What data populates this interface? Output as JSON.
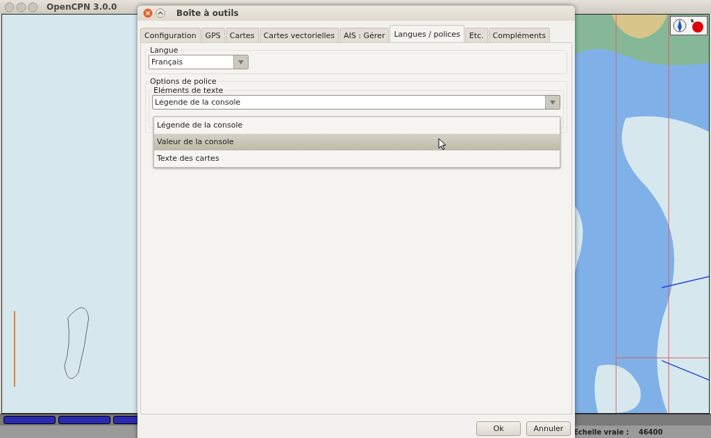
{
  "main_window": {
    "title": "OpenCPN 3.0.0"
  },
  "dialog": {
    "title": "Boîte à outils",
    "tabs": [
      {
        "label": "Configuration",
        "selected": false
      },
      {
        "label": "GPS",
        "selected": false
      },
      {
        "label": "Cartes",
        "selected": false
      },
      {
        "label": "Cartes vectorielles",
        "selected": false
      },
      {
        "label": "AIS : Gérer",
        "selected": false
      },
      {
        "label": "Langues / polices",
        "selected": true
      },
      {
        "label": "Etc.",
        "selected": false
      },
      {
        "label": "Compléments",
        "selected": false
      }
    ],
    "language": {
      "group_label": "Langue",
      "value": "Français"
    },
    "font_options": {
      "group_label": "Options de police",
      "text_elements": {
        "label": "Eléments de texte",
        "value": "Légende de la console",
        "expanded": true,
        "options": [
          {
            "label": "Légende de la console",
            "hovered": false
          },
          {
            "label": "Valeur de la console",
            "hovered": true
          },
          {
            "label": "Texte des cartes",
            "hovered": false
          }
        ]
      }
    },
    "buttons": [
      "Ok",
      "Annuler"
    ]
  },
  "status_bar": {
    "scale_label": "Echelle vraie :",
    "scale_value": "46400"
  }
}
